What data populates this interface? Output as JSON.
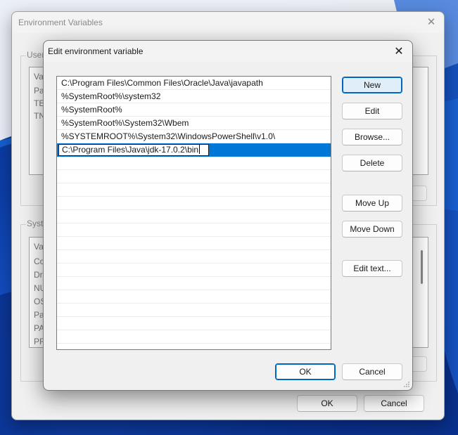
{
  "parent_dialog": {
    "title": "Environment Variables",
    "user_group_label": "User",
    "user_list_rows": [
      "Va",
      "Pa",
      "TE",
      "TN"
    ],
    "system_group_label": "Syste",
    "system_list_rows": [
      "Va",
      "Co",
      "Dr",
      "NU",
      "OS",
      "Pa",
      "PA",
      "PR"
    ],
    "ok_label": "OK",
    "cancel_label": "Cancel"
  },
  "dialog": {
    "title": "Edit environment variable",
    "entries": [
      "C:\\Program Files\\Common Files\\Oracle\\Java\\javapath",
      "%SystemRoot%\\system32",
      "%SystemRoot%",
      "%SystemRoot%\\System32\\Wbem",
      "%SYSTEMROOT%\\System32\\WindowsPowerShell\\v1.0\\"
    ],
    "editing_value": "C:\\Program Files\\Java\\jdk-17.0.2\\bin",
    "buttons": {
      "new": "New",
      "edit": "Edit",
      "browse": "Browse...",
      "delete": "Delete",
      "move_up": "Move Up",
      "move_down": "Move Down",
      "edit_text": "Edit text...",
      "ok": "OK",
      "cancel": "Cancel"
    }
  },
  "colors": {
    "accent": "#0078d7",
    "wallpaper": "#0b3fb0"
  }
}
